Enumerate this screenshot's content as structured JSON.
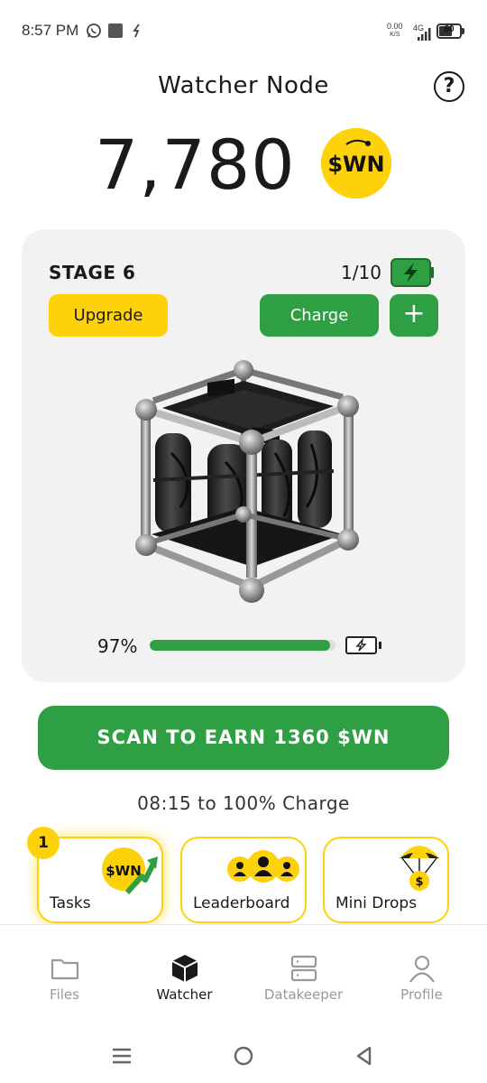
{
  "status_bar": {
    "time": "8:57 PM",
    "net_speed_value": "0.00",
    "net_speed_unit": "K/S",
    "network": "4G",
    "battery": "60"
  },
  "header": {
    "title": "Watcher Node",
    "help_icon": "question-circle-icon"
  },
  "balance": {
    "value": "7,780",
    "coin_label": "$WN"
  },
  "stage_card": {
    "stage_label": "STAGE 6",
    "charges": "1/10",
    "upgrade_label": "Upgrade",
    "charge_label": "Charge",
    "plus_label": "+",
    "progress_label": "97%",
    "progress_value": 0.97,
    "node_image": "server-cube-image"
  },
  "scan_button": {
    "label": "SCAN TO EARN 1360 $WN"
  },
  "charge_eta": "08:15  to 100% Charge",
  "tiles": [
    {
      "label": "Tasks",
      "icon": "wn-coin-arrow-icon",
      "badge": "1",
      "coin_label": "$WN"
    },
    {
      "label": "Leaderboard",
      "icon": "users-group-icon"
    },
    {
      "label": "Mini Drops",
      "icon": "parachute-coin-icon",
      "coin_label": "$"
    }
  ],
  "bottom_nav": [
    {
      "label": "Files",
      "icon": "folder-icon",
      "active": false
    },
    {
      "label": "Watcher",
      "icon": "cube-icon",
      "active": true
    },
    {
      "label": "Datakeeper",
      "icon": "server-icon",
      "active": false
    },
    {
      "label": "Profile",
      "icon": "user-icon",
      "active": false
    }
  ],
  "colors": {
    "accent_yellow": "#fdd20a",
    "accent_green": "#2ea043",
    "card_bg": "#f2f2f2"
  }
}
